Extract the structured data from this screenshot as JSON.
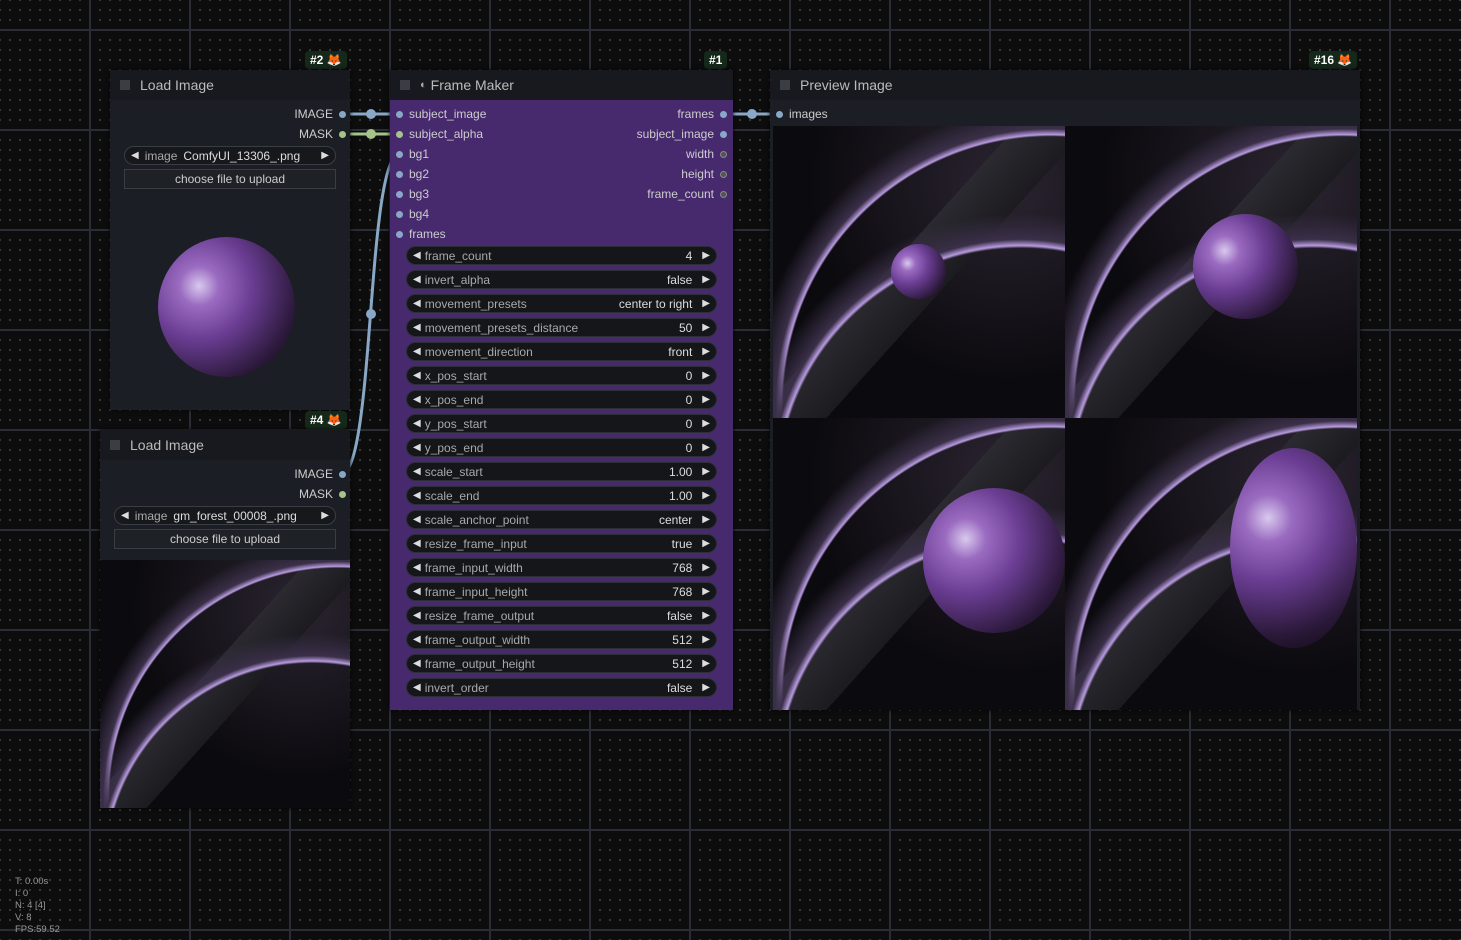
{
  "load1": {
    "id": "#2",
    "title": "Load Image",
    "outputs": [
      "IMAGE",
      "MASK"
    ],
    "image_label": "image",
    "image_value": "ComfyUI_13306_.png",
    "upload": "choose file to upload"
  },
  "load2": {
    "id": "#4",
    "title": "Load Image",
    "outputs": [
      "IMAGE",
      "MASK"
    ],
    "image_label": "image",
    "image_value": "gm_forest_00008_.png",
    "upload": "choose file to upload"
  },
  "frame": {
    "id": "#1",
    "title": "Frame Maker",
    "inputs": [
      "subject_image",
      "subject_alpha",
      "bg1",
      "bg2",
      "bg3",
      "bg4",
      "frames"
    ],
    "outputs": [
      "frames",
      "subject_image",
      "width",
      "height",
      "frame_count"
    ],
    "widgets": [
      {
        "name": "frame_count",
        "value": "4"
      },
      {
        "name": "invert_alpha",
        "value": "false"
      },
      {
        "name": "movement_presets",
        "value": "center to right"
      },
      {
        "name": "movement_presets_distance",
        "value": "50"
      },
      {
        "name": "movement_direction",
        "value": "front"
      },
      {
        "name": "x_pos_start",
        "value": "0"
      },
      {
        "name": "x_pos_end",
        "value": "0"
      },
      {
        "name": "y_pos_start",
        "value": "0"
      },
      {
        "name": "y_pos_end",
        "value": "0"
      },
      {
        "name": "scale_start",
        "value": "1.00"
      },
      {
        "name": "scale_end",
        "value": "1.00"
      },
      {
        "name": "scale_anchor_point",
        "value": "center"
      },
      {
        "name": "resize_frame_input",
        "value": "true"
      },
      {
        "name": "frame_input_width",
        "value": "768"
      },
      {
        "name": "frame_input_height",
        "value": "768"
      },
      {
        "name": "resize_frame_output",
        "value": "false"
      },
      {
        "name": "frame_output_width",
        "value": "512"
      },
      {
        "name": "frame_output_height",
        "value": "512"
      },
      {
        "name": "invert_order",
        "value": "false"
      }
    ]
  },
  "preview": {
    "id": "#16",
    "title": "Preview Image",
    "input": "images"
  },
  "stats": [
    "T: 0.00s",
    "I: 0",
    "N: 4 [4]",
    "V: 8",
    "FPS:59.52"
  ],
  "colors": {
    "node_body": "#1b1e24",
    "frame_body": "#472a6e",
    "image_link": "#89a8c8",
    "mask_link": "#a6c48a"
  }
}
